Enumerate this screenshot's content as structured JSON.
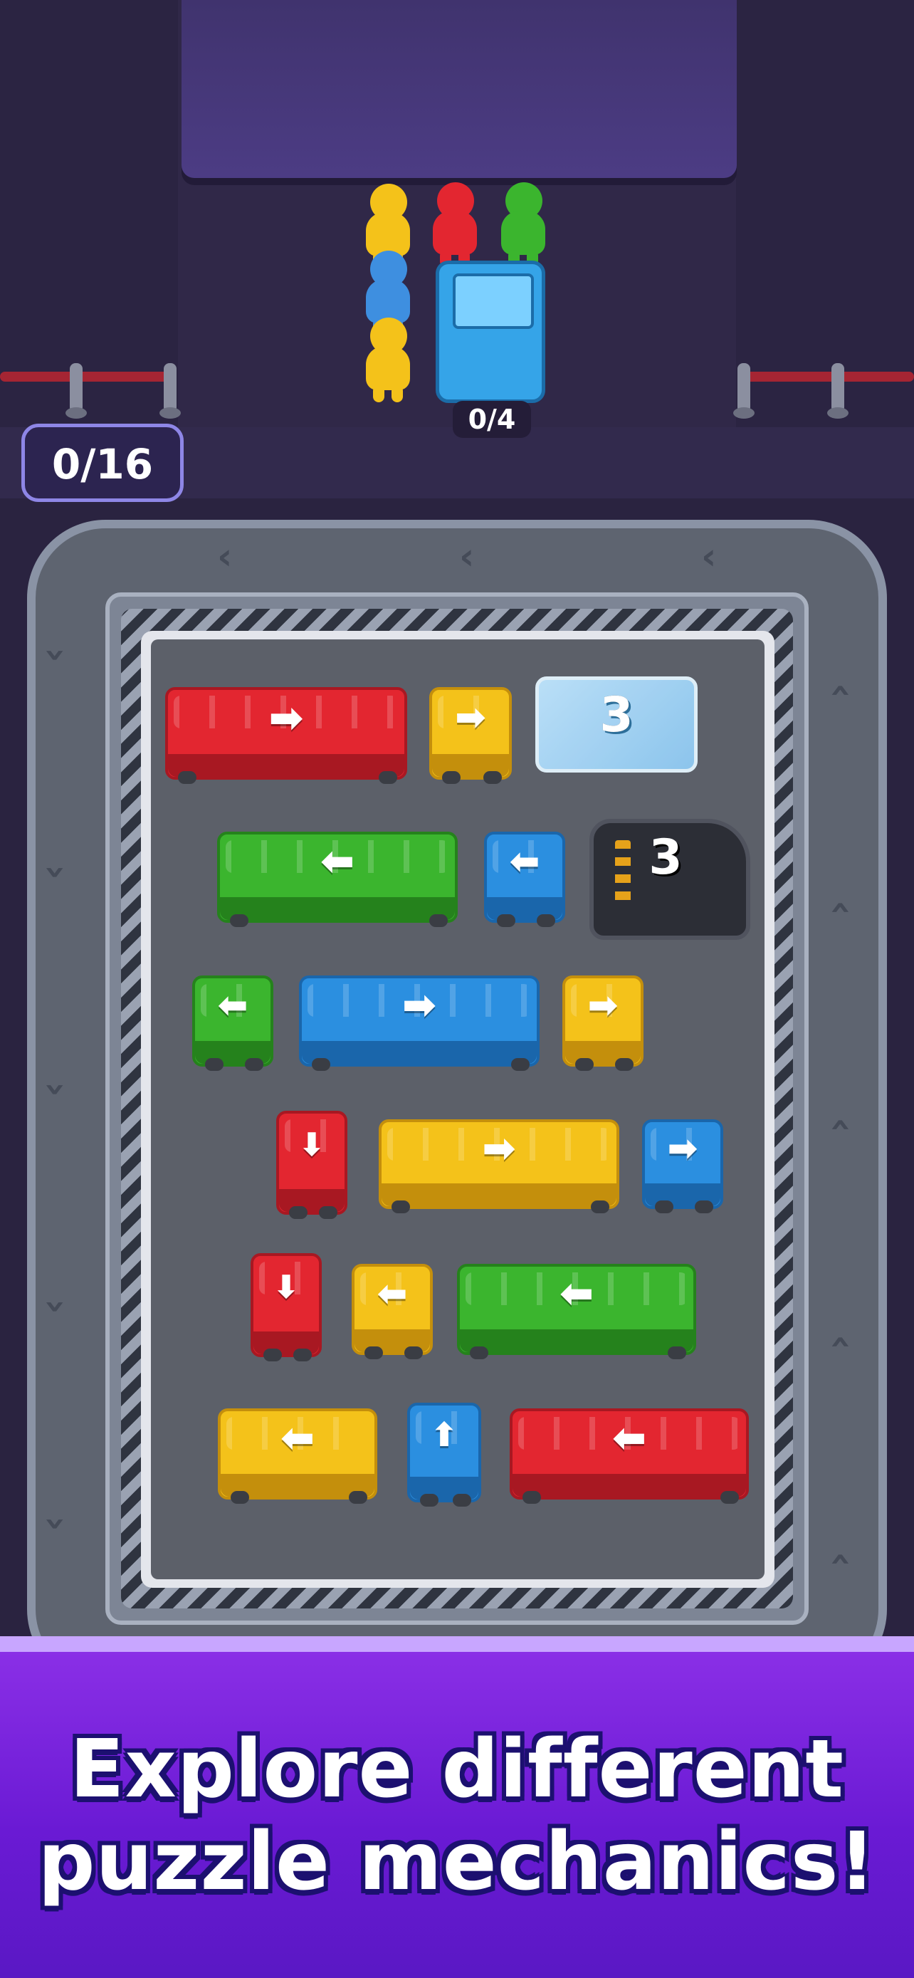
{
  "hud": {
    "level_progress": "0/16"
  },
  "bus": {
    "capacity_text": "0/4",
    "color": "#35a4e8"
  },
  "queue": [
    {
      "color": "#f4c21a",
      "color_name": "yellow"
    },
    {
      "color": "#3e8fe0",
      "color_name": "blue"
    },
    {
      "color": "#f4c21a",
      "color_name": "yellow"
    },
    {
      "color": "#e32630",
      "color_name": "red"
    },
    {
      "color": "#3bb52e",
      "color_name": "green"
    }
  ],
  "obstacles": {
    "ice_block": {
      "counter": "3",
      "icon": "ice-block"
    },
    "garage": {
      "counter": "3",
      "icon": "garage-tunnel"
    }
  },
  "vehicles": [
    {
      "id": "r1-red-bus",
      "color_name": "red",
      "seats": 6,
      "direction": "right",
      "arrow": "➡"
    },
    {
      "id": "r1-yellow-car",
      "color_name": "yellow",
      "seats": 2,
      "direction": "right",
      "arrow": "➡"
    },
    {
      "id": "r2-green-bus",
      "color_name": "green",
      "seats": 6,
      "direction": "left",
      "arrow": "⬅"
    },
    {
      "id": "r2-blue-car",
      "color_name": "blue",
      "seats": 2,
      "direction": "left",
      "arrow": "⬅"
    },
    {
      "id": "r3-green-car",
      "color_name": "green",
      "seats": 2,
      "direction": "left",
      "arrow": "⬅"
    },
    {
      "id": "r3-blue-bus",
      "color_name": "blue",
      "seats": 6,
      "direction": "right",
      "arrow": "➡"
    },
    {
      "id": "r3-yellow-car",
      "color_name": "yellow",
      "seats": 2,
      "direction": "right",
      "arrow": "➡"
    },
    {
      "id": "r4-red-car",
      "color_name": "red",
      "seats": 2,
      "direction": "down",
      "arrow": "⬇"
    },
    {
      "id": "r4-yellow-bus",
      "color_name": "yellow",
      "seats": 6,
      "direction": "right",
      "arrow": "➡"
    },
    {
      "id": "r4-blue-car",
      "color_name": "blue",
      "seats": 2,
      "direction": "right",
      "arrow": "➡"
    },
    {
      "id": "r5-red-car",
      "color_name": "red",
      "seats": 2,
      "direction": "down",
      "arrow": "⬇"
    },
    {
      "id": "r5-yellow-car",
      "color_name": "yellow",
      "seats": 2,
      "direction": "left",
      "arrow": "⬅"
    },
    {
      "id": "r5-green-bus",
      "color_name": "green",
      "seats": 6,
      "direction": "left",
      "arrow": "⬅"
    },
    {
      "id": "r6-yellow-van",
      "color_name": "yellow",
      "seats": 4,
      "direction": "left",
      "arrow": "⬅"
    },
    {
      "id": "r6-blue-car",
      "color_name": "blue",
      "seats": 2,
      "direction": "up",
      "arrow": "⬆"
    },
    {
      "id": "r6-red-bus",
      "color_name": "red",
      "seats": 6,
      "direction": "left",
      "arrow": "⬅"
    }
  ],
  "colors": {
    "red": "#e32630",
    "yellow": "#f4c21a",
    "green": "#3bb52e",
    "blue": "#2b8fe0",
    "promo_purple": "#7a22e0"
  },
  "promo": {
    "line1": "Explore different",
    "line2": "puzzle mechanics!"
  }
}
